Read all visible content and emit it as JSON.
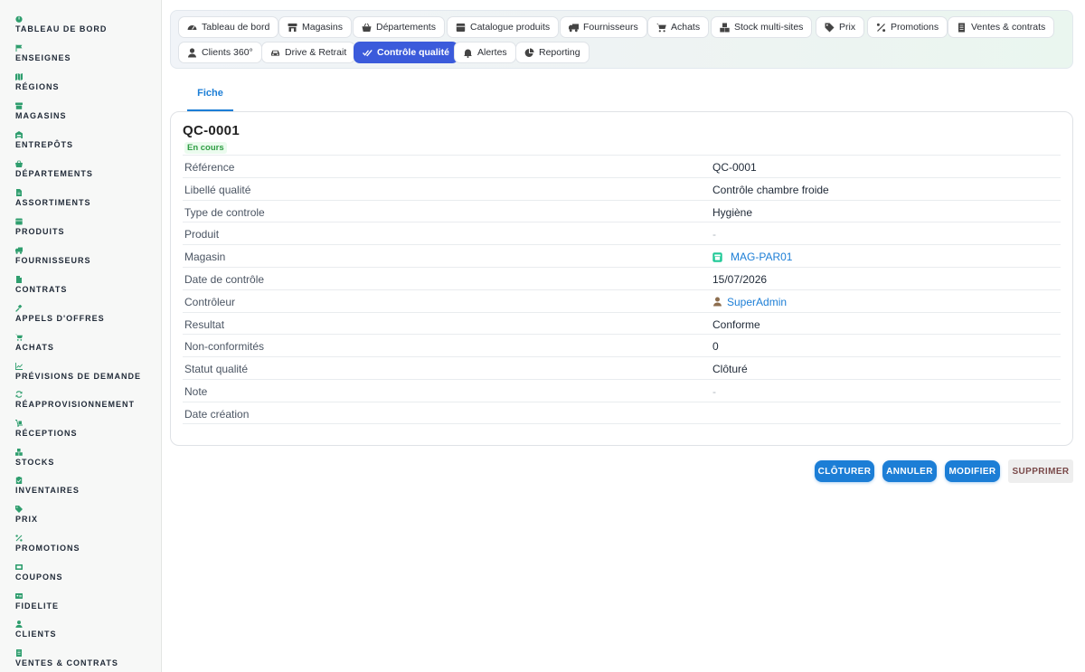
{
  "sidebar": {
    "items": [
      {
        "label": "TABLEAU DE BORD",
        "icon": "dashboard-icon"
      },
      {
        "label": "ENSEIGNES",
        "icon": "flag-icon"
      },
      {
        "label": "RÉGIONS",
        "icon": "map-icon"
      },
      {
        "label": "MAGASINS",
        "icon": "store-icon"
      },
      {
        "label": "ENTREPÔTS",
        "icon": "warehouse-icon"
      },
      {
        "label": "DÉPARTEMENTS",
        "icon": "basket-icon"
      },
      {
        "label": "ASSORTIMENTS",
        "icon": "file-icon"
      },
      {
        "label": "PRODUITS",
        "icon": "box-icon"
      },
      {
        "label": "FOURNISSEURS",
        "icon": "truck-icon"
      },
      {
        "label": "CONTRATS",
        "icon": "document-icon"
      },
      {
        "label": "APPELS D'OFFRES",
        "icon": "gavel-icon"
      },
      {
        "label": "ACHATS",
        "icon": "cart-icon"
      },
      {
        "label": "PRÉVISIONS DE DEMANDE",
        "icon": "chart-icon"
      },
      {
        "label": "RÉAPPROVISIONNEMENT",
        "icon": "refresh-icon"
      },
      {
        "label": "RÉCEPTIONS",
        "icon": "dolly-icon"
      },
      {
        "label": "STOCKS",
        "icon": "cubes-icon"
      },
      {
        "label": "INVENTAIRES",
        "icon": "clipboard-icon"
      },
      {
        "label": "PRIX",
        "icon": "tags-icon"
      },
      {
        "label": "PROMOTIONS",
        "icon": "percent-icon"
      },
      {
        "label": "COUPONS",
        "icon": "ticket-icon"
      },
      {
        "label": "FIDELITE",
        "icon": "card-icon"
      },
      {
        "label": "CLIENTS",
        "icon": "user-icon"
      },
      {
        "label": "VENTES & CONTRATS",
        "icon": "receipt-icon"
      }
    ],
    "accent": "#2f9e6e"
  },
  "topnav": {
    "pills": [
      {
        "label": "Tableau de bord",
        "icon": "gauge-icon"
      },
      {
        "label": "Magasins",
        "icon": "store-icon"
      },
      {
        "label": "Départements",
        "icon": "basket-icon"
      },
      {
        "label": "Catalogue produits",
        "icon": "grid-icon"
      },
      {
        "label": "Fournisseurs",
        "icon": "truck-icon"
      },
      {
        "label": "Achats",
        "icon": "cart-icon"
      },
      {
        "label": "Stock multi-sites",
        "icon": "cubes-icon"
      },
      {
        "label": "Prix",
        "icon": "tag-icon"
      },
      {
        "label": "Promotions",
        "icon": "percent-icon"
      },
      {
        "label": "Ventes & contrats",
        "icon": "receipt-icon"
      },
      {
        "label": "Clients 360°",
        "icon": "user-icon"
      },
      {
        "label": "Drive & Retrait",
        "icon": "car-icon"
      },
      {
        "label": "Contrôle qualité",
        "icon": "check-double-icon",
        "active": true
      },
      {
        "label": "Alertes",
        "icon": "bell-icon"
      },
      {
        "label": "Reporting",
        "icon": "pie-icon"
      }
    ],
    "active_color": "#3b5bdb"
  },
  "tabs": {
    "fiche": "Fiche"
  },
  "record": {
    "title": "QC-0001",
    "status": "En cours",
    "status_color": "#2f9e44",
    "fields": [
      {
        "label": "Référence",
        "value": "QC-0001"
      },
      {
        "label": "Libellé qualité",
        "value": "Contrôle chambre froide"
      },
      {
        "label": "Type de controle",
        "value": "Hygiène"
      },
      {
        "label": "Produit",
        "value": "-"
      },
      {
        "label": "Magasin",
        "value": "MAG-PAR01",
        "icon": "store-icon",
        "link": true
      },
      {
        "label": "Date de contrôle",
        "value": "15/07/2026"
      },
      {
        "label": "Contrôleur",
        "value": "SuperAdmin",
        "icon": "user-icon",
        "link": true
      },
      {
        "label": "Resultat",
        "value": "Conforme"
      },
      {
        "label": "Non-conformités",
        "value": "0"
      },
      {
        "label": "Statut qualité",
        "value": "Clôturé"
      },
      {
        "label": "Note",
        "value": "-"
      },
      {
        "label": "Date création",
        "value": ""
      }
    ]
  },
  "actions": {
    "close": "CLÔTURER",
    "cancel": "ANNULER",
    "edit": "MODIFIER",
    "delete": "SUPPRIMER",
    "primary_color": "#1c7ed6"
  }
}
